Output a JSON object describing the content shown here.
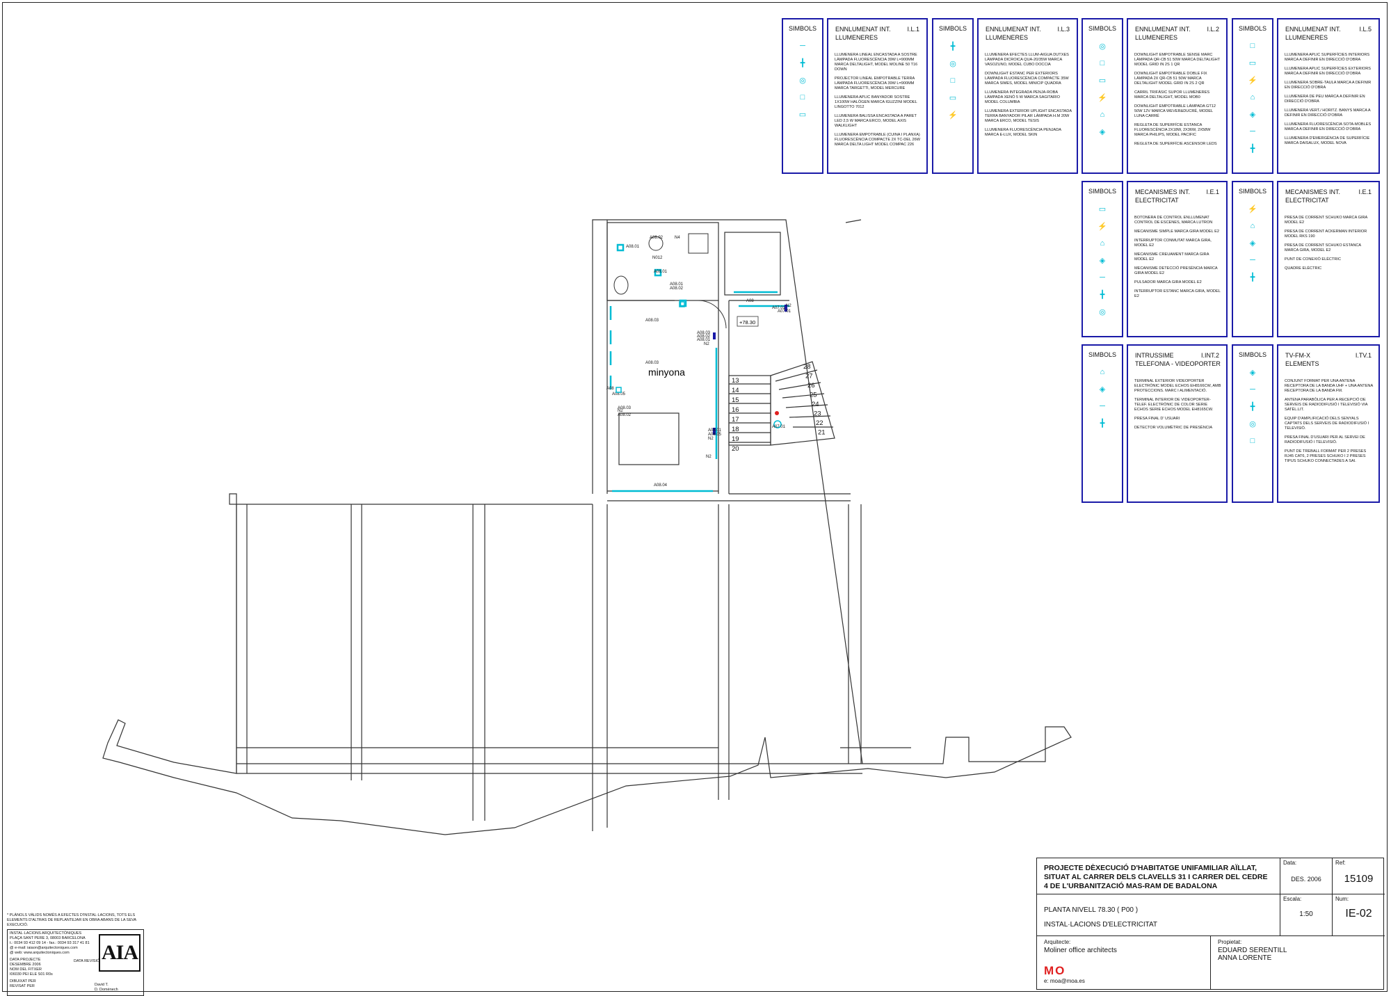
{
  "legend_panels": [
    {
      "symbols_label": "SIMBOLS",
      "title": "ENNLUMENAT INT.",
      "code": "I.L.1",
      "subtitle": "LLUMENERES",
      "items": [
        "LLUMENERA LINEAL ENCASTADA A SOSTRE LÀMPADA FLUORESCÈNCIA 39W L=900mm MARCA DELTALIGHT, MODEL MOLINE 50 T16 DOWN",
        "PROJECTOR LINEAL EMPOTRABLE TERRA LÀMPADA FLUORESCÈNCIA 39W L=900mm MARCA TARGETTI, MODEL MERCURE",
        "LLUMENERA APLIC BANYADOR SOSTRE 1x100W HALÒGEN MARCA IGUZZINI MODEL LINGOTTO 7012",
        "LLUMENERA BALISSA ENCASTADA A PARET LED 2,5 W MARCA ERCO, MODEL AXIS WALKLIGHT",
        "LLUMENERA EMPOTRABLE (CUINA I PLANXA) FLUORESCÈNCIA COMPACTE 2x TC-DEL 26W MARCA DELTA LIGHT MODEL COMPAC 226"
      ]
    },
    {
      "symbols_label": "SIMBOLS",
      "title": "ENNLUMENAT INT.",
      "code": "I.L.3",
      "subtitle": "LLUMENERES",
      "items": [
        "LLUMENERA EFECTES LLUM-AIGUA DUTXES LÀMPADA DICROICA QUA-20/35W MARCA VASOZUNO, MODEL CUBO DOCCIA",
        "DOWNLIGHT ESTANC PER EXTERIORS LÀMPADA FLUORESCÈNCIA COMPACTE 35W MARCA SIMES, MODEL MINICIP QUADRA",
        "LLUMENERA INTEGRADA PENJA-ROBA LÀMPADA XENÒ 5 W MARCA SAGITARIO MODEL COLUMBIA",
        "LLUMENERA EXTERIOR UPLIGHT ENCASTADA TERRA BANYADOR PILAR LÀMPADA H.M 20W MARCA ERCO, MODEL TESIS",
        "LLUMENERA FLUORESCÈNCIA PENJADA MARCA E-LUX, MODEL SKIN"
      ]
    },
    {
      "symbols_label": "SIMBOLS",
      "title": "ENNLUMENAT INT.",
      "code": "I.L.2",
      "subtitle": "LLUMENERES",
      "items": [
        "DOWNLIGHT EMPOTRABLE SENSE MARC LÀMPADA QR-CB 51 50W MARCA DELTALIGHT MODEL GRID IN 2S 1 QR",
        "DOWNLIGHT EMPOTRABLE DOBLE FIX LÀMPADA 2x QR-CB 51 50W MARCA DELTALIGHT MODEL GRID IN 2S 2 QR",
        "CARRIL TRIFÀSIC SUPOR LLUMENERES MARCA DELTALIGHT, MODEL MOB0",
        "DOWNLIGHT EMPOTRABLE LÀMPADA GT12 50W 12V MARCA WEVER&DUCRÉ, MODEL LUNA CARRÉ",
        "REGLETA DE SUPERFÍCIE ESTANCA FLUORESCÈNCIA 2x18w, 2x36W, 2x58W MARCA PHILIPS, MODEL PACIFIC",
        "REGLETA DE SUPERFÍCIE ASCENSOR LEDS"
      ]
    },
    {
      "symbols_label": "SIMBOLS",
      "title": "ENNLUMENAT INT.",
      "code": "I.L.5",
      "subtitle": "LLUMENERES",
      "items": [
        "LLUMENERA APLIC SUPERFÍCIES INTERIORS MARCA A DEFINIR EN DIRECCIÓ D'OBRA",
        "LLUMENERA APLIC SUPERFÍCIES EXTERIORS MARCA A DEFINIR EN DIRECCIÓ D'OBRA",
        "LLUMENERA SOBRE-TAULA MARCA A DEFINIR EN DIRECCIÓ D'OBRA",
        "LLUMENERA DE PEU MARCA A DEFINIR EN DIRECCIÓ D'OBRA",
        "LLUMENERA VERT./ HORITZ. BANYS MARCA A DEFINIR EN DIRECCIÓ D'OBRA",
        "LLUMENERA FLUORESCÈNCIA SOTA-MOBLES MARCA A DEFINIR EN DIRECCIÓ D'OBRA",
        "LLUMENERA D'EMERGÈNCIA DE SUPERFÍCIE MARCA DAISALUX, MODEL NOVA"
      ]
    },
    {
      "symbols_label": "SIMBOLS",
      "title": "MECANISMES INT.",
      "code": "I.E.1",
      "subtitle": "ELECTRICITAT",
      "items": [
        "BOTONERA DE CONTROL ENLLUMENAT CONTROL DE ESCENES, MARCA LUTRON",
        "MECANISME SIMPLE MARCA GIRA MODEL E2",
        "INTERRUPTOR CONMUTAT MARCA GIRA, MODEL E2",
        "MECANISME CREUAMENT MARCA GIRA MODEL E2",
        "MECANISME DETECCIÓ PRESÈNCIA MARCA GIRA MODEL E2",
        "PULSADOR MARCA GIRA MODEL E2",
        "INTERRUPTOR ESTANC MARCA GIRA, MODEL E2"
      ]
    },
    {
      "symbols_label": "SIMBOLS",
      "title": "MECANISMES INT.",
      "code": "I.E.1",
      "subtitle": "ELECTRICITAT",
      "items": [
        "PRESA DE CORRENT SCHUKO MARCA GIRA MODEL E2",
        "PRESA DE CORRENT ACKERMAN INTERIOR MODEL RKS 190",
        "PRESA DE CORRENT SCHUKO ESTANCA MARCA GIRA, MODEL E2",
        "PUNT DE CONEXIÓ ELÈCTRIC",
        "QUADRE ELÈCTRIC"
      ]
    },
    {
      "symbols_label": "SIMBOLS",
      "title": "INTRUSSIME",
      "code": "I.INT.2",
      "subtitle": "TELEFONIA - VIDEOPORTER",
      "items": [
        "TERMINAL EXTERIOR VIDEOPORTER ELECTRÒNIC MODEL ECHOS EH8166CW, AMB PROTECCIONS. MARC I ALIMENTACIÓ.",
        "TERMINAL INTERIOR DE VIDEOPORTER-TELEF. ELECTRÒNIC DE COLOR SERIE ECHOS SERIE ECHOS MODEL EH8165CW.",
        "PRESA FINAL D' USUARI",
        "DETECTOR VOLUMÈTRIC DE PRESÈNCIA"
      ]
    },
    {
      "symbols_label": "SIMBOLS",
      "title": "TV-FM-X",
      "code": "I.TV.1",
      "subtitle": "ELEMENTS",
      "items": [
        "CONJUNT FORMAT PER UNA ANTENA RECEPTORA DE LA BANDA UHF + UNA ANTENA RECEPTORA DE LA BANDA FM.",
        "ANTENA PARABÒLICA PER A RECEPCIÓ DE SERVEIS DE RADIODIFUSIÓ I TELEVISIÓ VIA SATÈL.LIT.",
        "EQUIP D'AMPLIFICACIÓ DELS SENYALS CAPTATS DELS SERVEIS DE RADIODIFUSIÓ I TELEVISIÓ.",
        "PRESA FINAL D'USUARI PER AL SERVEI DE RADIODIFUSIÓ I TELEVISIÓ.",
        "PUNT DE TREBALL FORMAT PER 2 PRESES RJ45 CAT6, 2 PRESES SCHUKO I 2 PRESES TIPUS SCHUKO CONNECTADES A SAI."
      ]
    }
  ],
  "plan": {
    "room_label": "minyona",
    "level_mark": "+78.30",
    "tags": [
      "A08.01",
      "A08.02",
      "N4",
      "N012",
      "A08.01",
      "A08.01",
      "A08.02",
      "A08",
      "A07.01",
      "N2",
      "A07.01",
      "A08.03",
      "A08.03",
      "A08.02",
      "A08.01",
      "N2",
      "A08.03",
      "A08",
      "A08.03",
      "A08.05",
      "N2",
      "A08.02",
      "A08.01",
      "A08.05",
      "N2",
      "A07.01",
      "N2",
      "A08.04"
    ],
    "stairs_left": [
      "13",
      "14",
      "15",
      "16",
      "17",
      "18",
      "19",
      "20"
    ],
    "stairs_right": [
      "28",
      "27",
      "26",
      "25",
      "24",
      "23",
      "22",
      "21"
    ]
  },
  "title_block": {
    "project": "PROJECTE DÈXECUCIÓ D'HABITATGE UNIFAMILIAR AÏLLAT, SITUAT AL CARRER DELS CLAVELLS 31 I CARRER DEL CEDRE 4 DE L'URBANITZACIÓ MAS-RAM DE BADALONA",
    "date_label": "Data:",
    "date": "DES. 2006",
    "ref_label": "Ref:",
    "ref": "15109",
    "plan_name": "PLANTA NIVELL 78.30 ( P00 )",
    "plan_subject": "INSTAL·LACIONS D'ELECTRICITAT",
    "scale_label": "Escala:",
    "scale": "1:50",
    "num_label": "Num:",
    "num": "IE-02",
    "architect_label": "Arquitecte:",
    "architect": "Moliner office architects",
    "email": "e: moa@moa.es",
    "owner_label": "Propietat:",
    "owner1": "EDUARD SERENTILL",
    "owner2": "ANNA LORENTE",
    "logo": "MO"
  },
  "aia": {
    "note": "* PLÀNOLS VÀLIDS NOMÉS A EFECTES D'INSTAL·LACIONS, TOTS ELS ELEMENTS D'ALTRAS DE REPLANTEJAR EN OBRA ABANS DE LA SEVA EXECUCIÓ.",
    "company": "INSTAL·LACIONS ARQUITECTÒNIQUES",
    "address": "PLAÇA SANT PERE 3, 08003 BARCELONA",
    "phone": "t.: 0034 93 412 09 14 - fax.: 0034 93 317 41 81",
    "mail": "@ e-mail: iaiaon@arquitectoniques.com",
    "web": "@ web: www.arquitectoniques.com",
    "data_label": "DATA PROJECTE",
    "data": "DESEMBRE 2006",
    "revision_label": "DATA REVISIÓ",
    "file_label": "NOM DEL FITXER",
    "file": "I06030 PEI ELE S01 R0s",
    "drawn_label": "DIBUIXAT PER",
    "drawn": "David T.",
    "revised_label": "REVISAT PER",
    "revised": "D. Domènech",
    "logo": "AIA"
  },
  "colors": {
    "border": "#1a1aa8",
    "cyan": "#00bcd4",
    "blue": "#1a1aa8",
    "red": "#e02020",
    "line": "#333333"
  }
}
